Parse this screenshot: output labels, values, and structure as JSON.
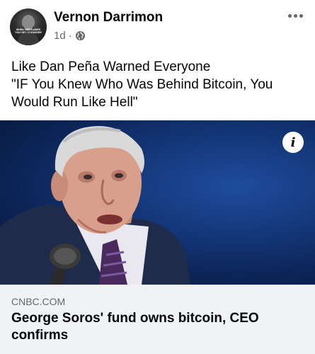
{
  "post": {
    "author": "Vernon Darrimon",
    "time": "1d",
    "separator": "·",
    "privacy_icon": "globe-icon",
    "more_icon": "more-options-icon",
    "avatar_caption_line1": "WHEN LIFE EASIER",
    "avatar_caption_line2": "YOU GET STRONGER",
    "text_lines": [
      "Like Dan Peña Warned Everyone",
      "\"IF You Knew Who Was Behind Bitcoin, You",
      "Would Run Like Hell\""
    ]
  },
  "image": {
    "info_label": "i"
  },
  "link": {
    "domain": "CNBC.COM",
    "title_lines": [
      "George Soros' fund owns bitcoin, CEO",
      "confirms"
    ]
  },
  "colors": {
    "text": "#050505",
    "secondary": "#65676b",
    "card_bg": "#f0f2f5",
    "image_bg": "#143779"
  }
}
